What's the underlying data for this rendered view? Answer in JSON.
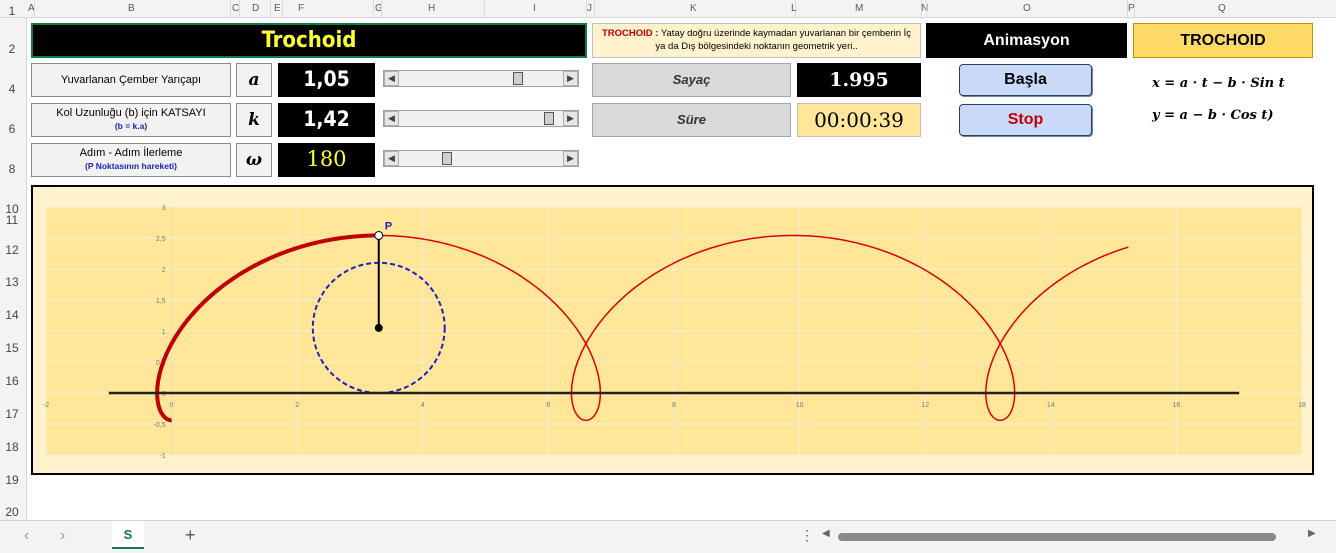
{
  "columns": [
    {
      "label": "A"
    },
    {
      "label": "B"
    },
    {
      "label": "C"
    },
    {
      "label": "D"
    },
    {
      "label": "E"
    },
    {
      "label": "F"
    },
    {
      "label": "G"
    },
    {
      "label": "H"
    },
    {
      "label": "I"
    },
    {
      "label": "J"
    },
    {
      "label": "K"
    },
    {
      "label": "L"
    },
    {
      "label": "M"
    },
    {
      "label": "N"
    },
    {
      "label": "O"
    },
    {
      "label": "P"
    },
    {
      "label": "Q"
    }
  ],
  "rows": [
    "1",
    "2",
    "4",
    "6",
    "8",
    "10",
    "11",
    "12",
    "13",
    "14",
    "15",
    "16",
    "17",
    "18",
    "19",
    "20"
  ],
  "title": "Trochoid",
  "description": {
    "highlight": "TROCHOID :",
    "text": " Yatay doğru üzerinde kaymadan yuvarlanan bir çemberin İç ya da Dış bölgesindeki noktanın geometrik yeri.."
  },
  "animasyon_label": "Animasyon",
  "trochoid_label": "TROCHOID",
  "params": [
    {
      "label": "Yuvarlanan Çember Yarıçapı",
      "sub": "",
      "symbol": "a",
      "value": "1,05",
      "thumb_frac": 0.74,
      "color": "#ffffff"
    },
    {
      "label": "Kol Uzunluğu (b) için KATSAYI",
      "sub": "(b = k.a)",
      "symbol": "k",
      "value": "1,42",
      "thumb_frac": 0.94,
      "color": "#ffffff"
    },
    {
      "label": "Adım - Adım İlerleme",
      "sub": "(P  Noktasının hareketi)",
      "symbol": "ω",
      "value": "180",
      "thumb_frac": 0.28,
      "color": "#ffff33"
    }
  ],
  "counter": {
    "label": "Sayaç",
    "value": "1.995"
  },
  "duration": {
    "label": "Süre",
    "value": "00:00:39"
  },
  "buttons": {
    "start": "Başla",
    "stop": "Stop"
  },
  "formulas": {
    "x": "x = a · t − b · Sin t",
    "y": "y = a − b · Cos t)"
  },
  "chart_data": {
    "type": "line",
    "title": "",
    "point_label": "P",
    "xlim": [
      -2,
      18
    ],
    "ylim": [
      -1,
      3
    ],
    "x_ticks": [
      "-2",
      "0",
      "2",
      "4",
      "6",
      "8",
      "10",
      "12",
      "14",
      "16",
      "18"
    ],
    "y_ticks": [
      "-1",
      "-0,5",
      "0",
      "0,5",
      "1",
      "1,5",
      "2",
      "2,5",
      "3"
    ],
    "series": [
      {
        "curve": "trochoid",
        "a": 1.05,
        "k": 1.42,
        "t_range": [
          0,
          15.2
        ],
        "color": "#e00000"
      },
      {
        "curve": "trochoid-traced",
        "a": 1.05,
        "k": 1.42,
        "t_range": [
          0,
          3.1416
        ],
        "color": "#c00000"
      },
      {
        "curve": "rolling-circle",
        "center": [
          3.2987,
          1.05
        ],
        "radius": 1.05,
        "color": "#2020c0"
      },
      {
        "curve": "ground-line",
        "x_range": [
          -1,
          17
        ],
        "y": 0,
        "color": "#222222"
      },
      {
        "curve": "arm",
        "from": [
          3.2987,
          1.05
        ],
        "to": [
          3.2987,
          2.541
        ],
        "color": "#000000"
      }
    ]
  },
  "sheet_tab": "S",
  "colors": {
    "title_text": "#ffff33",
    "panel_bg": "#fff2cc",
    "plot_bg": "#ffe699",
    "value_bg": "#000000",
    "duration_bg": "#ffe699",
    "stop_text": "#c00000",
    "highlight": "#c00000"
  },
  "icons": {
    "nav_prev": "chevron-left-icon",
    "nav_next": "chevron-right-icon",
    "add": "plus-icon",
    "more": "more-vertical-icon"
  }
}
